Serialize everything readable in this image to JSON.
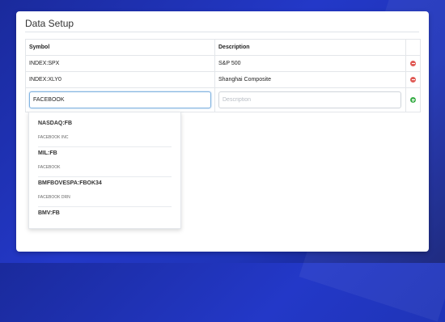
{
  "panel": {
    "title": "Data Setup"
  },
  "grid": {
    "headers": {
      "symbol": "Symbol",
      "description": "Description"
    },
    "rows": [
      {
        "symbol": "INDEX:SPX",
        "description": "S&P 500"
      },
      {
        "symbol": "INDEX:XLY0",
        "description": "Shanghai Composite"
      }
    ],
    "new_row": {
      "symbol_value": "FACEBOOK",
      "description_placeholder": "Description"
    }
  },
  "suggestions": [
    {
      "symbol": "NASDAQ:FB",
      "description": "FACEBOOK INC"
    },
    {
      "symbol": "MIL:FB",
      "description": "FACEBOOK"
    },
    {
      "symbol": "BMFBOVESPA:FBOK34",
      "description": "FACEBOOK DRN"
    },
    {
      "symbol": "BMV:FB",
      "description": ""
    }
  ],
  "colors": {
    "remove": "#e05a55",
    "add": "#3cae4a",
    "focus": "#7fb2e0"
  },
  "icons": {
    "remove": "minus-circle-icon",
    "add": "plus-circle-icon"
  }
}
